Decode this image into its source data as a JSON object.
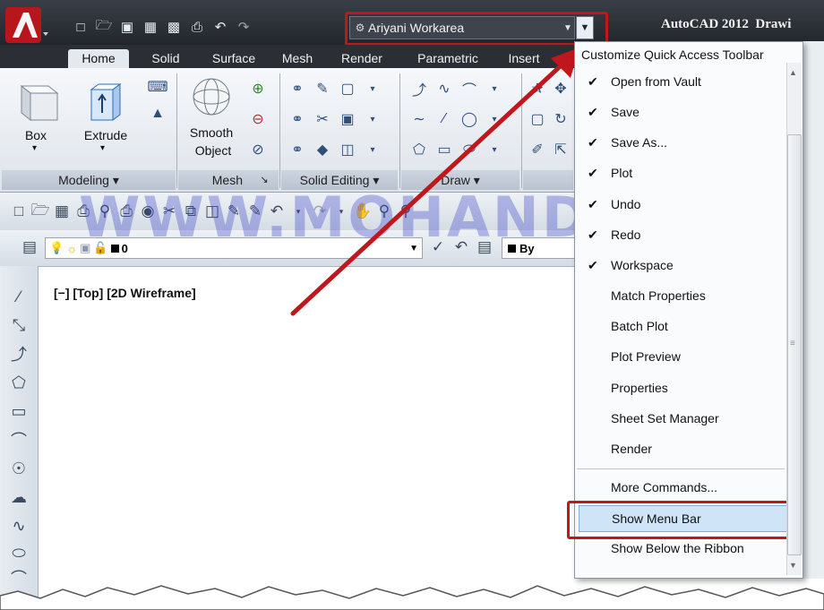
{
  "titlebar": {
    "app_title": "AutoCAD 2012",
    "doc_title": "Drawi",
    "workspace": "Ariyani Workarea",
    "qat_icons": [
      "new-icon",
      "open-icon",
      "save-to-vault-icon",
      "save-icon",
      "save-as-icon",
      "plot-icon",
      "undo-icon",
      "redo-icon"
    ]
  },
  "tabs": [
    "Home",
    "Solid",
    "Surface",
    "Mesh",
    "Render",
    "Parametric",
    "Insert"
  ],
  "active_tab": "Home",
  "ribbon": {
    "box_label": "Box",
    "extrude_label": "Extrude",
    "smooth_label_1": "Smooth",
    "smooth_label_2": "Object",
    "panels": [
      "Modeling ▾",
      "Mesh",
      "↘",
      "Solid Editing ▾",
      "Draw ▾"
    ]
  },
  "layer_toolbar": {
    "layer_name": "0",
    "color_value": "By"
  },
  "viewport": {
    "label": "[−] [Top] [2D Wireframe]"
  },
  "watermark": "WWW.MOHANDES.ORG",
  "menu": {
    "title": "Customize Quick Access Toolbar",
    "items": [
      {
        "label": "Open from Vault",
        "checked": "✔"
      },
      {
        "label": "Save",
        "checked": "✔"
      },
      {
        "label": "Save As...",
        "checked": "✔"
      },
      {
        "label": "Plot",
        "checked": "✔"
      },
      {
        "label": "Undo",
        "checked": "✔"
      },
      {
        "label": "Redo",
        "checked": "✔"
      },
      {
        "label": "Workspace",
        "checked": "✔"
      },
      {
        "label": "Match Properties",
        "checked": ""
      },
      {
        "label": "Batch Plot",
        "checked": ""
      },
      {
        "label": "Plot Preview",
        "checked": ""
      },
      {
        "label": "Properties",
        "checked": ""
      },
      {
        "label": "Sheet Set Manager",
        "checked": ""
      },
      {
        "label": "Render",
        "checked": ""
      }
    ],
    "more_commands": "More Commands...",
    "show_menu_bar": "Show Menu Bar",
    "show_below_ribbon": "Show Below the Ribbon"
  },
  "colors": {
    "highlight": "#c0171c",
    "arrow": "#c0171c",
    "watermark": "#3c46c8"
  }
}
